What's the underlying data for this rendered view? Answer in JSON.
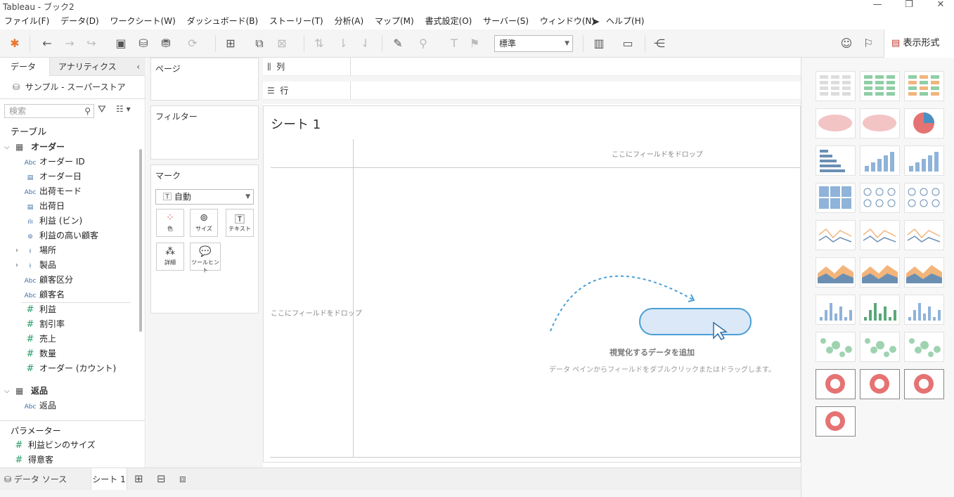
{
  "window": {
    "title": "Tableau - ブック2"
  },
  "menu": [
    "ファイル(F)",
    "データ(D)",
    "ワークシート(W)",
    "ダッシュボード(B)",
    "ストーリー(T)",
    "分析(A)",
    "マップ(M)",
    "書式設定(O)",
    "サーバー(S)",
    "ウィンドウ(N)",
    "ヘルプ(H)"
  ],
  "toolbar": {
    "fit_select": "標準",
    "show_me_label": "表示形式"
  },
  "left_pane": {
    "tabs": [
      "データ",
      "アナリティクス"
    ],
    "datasource": "サンプル - スーパーストア",
    "search_placeholder": "検索",
    "tables_header": "テーブル",
    "groups": [
      {
        "name": "オーダー",
        "fields": [
          {
            "type": "Abc",
            "name": "オーダー ID"
          },
          {
            "type": "date",
            "name": "オーダー日"
          },
          {
            "type": "Abc",
            "name": "出荷モード"
          },
          {
            "type": "date",
            "name": "出荷日"
          },
          {
            "type": "bin",
            "name": "利益 (ビン)"
          },
          {
            "type": "set",
            "name": "利益の高い顧客"
          },
          {
            "type": "hier",
            "name": "場所"
          },
          {
            "type": "hier",
            "name": "製品"
          },
          {
            "type": "Abc",
            "name": "顧客区分"
          },
          {
            "type": "Abc",
            "name": "顧客名"
          },
          {
            "type": "#",
            "name": "利益"
          },
          {
            "type": "#",
            "name": "割引率"
          },
          {
            "type": "#",
            "name": "売上"
          },
          {
            "type": "#",
            "name": "数量"
          },
          {
            "type": "#",
            "name": "オーダー (カウント)"
          }
        ]
      },
      {
        "name": "返品",
        "fields": [
          {
            "type": "Abc",
            "name": "返品"
          }
        ]
      }
    ],
    "parameters_header": "パラメーター",
    "parameters": [
      "利益ビンのサイズ",
      "得意客"
    ]
  },
  "shelves": {
    "pages": "ページ",
    "filters": "フィルター",
    "marks": "マーク",
    "mark_type": "自動",
    "mark_buttons": [
      "色",
      "サイズ",
      "テキスト",
      "詳細",
      "ツールヒント"
    ],
    "columns": "列",
    "rows": "行"
  },
  "viz": {
    "sheet_title": "シート 1",
    "drop_here_top": "ここにフィールドをドロップ",
    "drop_here_left": "ここにフィールドをドロップ",
    "add_data_title": "視覚化するデータを追加",
    "add_data_hint": "データ ペインからフィールドをダブルクリックまたはドラッグします。"
  },
  "bottom": {
    "datasource_tab": "データ ソース",
    "sheet_tab": "シート 1"
  }
}
